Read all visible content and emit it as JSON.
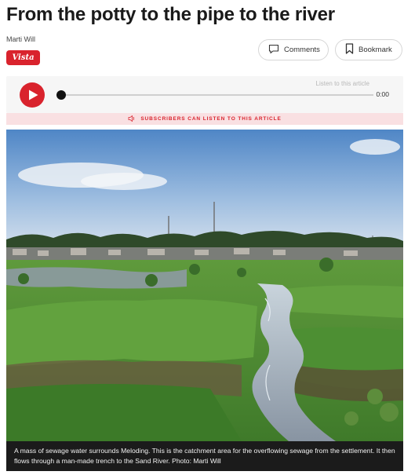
{
  "article": {
    "headline": "From the potty to the pipe to the river",
    "author": "Marti Will",
    "badge": "Vista"
  },
  "actions": {
    "comments_label": "Comments",
    "bookmark_label": "Bookmark"
  },
  "audio": {
    "listen_label": "Listen to this article",
    "time": "0:00",
    "progress": 0,
    "subscribers_notice": "SUBSCRIBERS CAN LISTEN TO THIS ARTICLE"
  },
  "photo": {
    "caption": "A mass of sewage water surrounds Meloding. This is the catchment area for the overflowing sewage from the settlement. It then flows through a man-made trench to the Sand River. Photo: Marti Will"
  },
  "icons": {
    "play": "play-icon",
    "comments": "speech-bubble-icon",
    "bookmark": "bookmark-icon",
    "speaker": "speaker-icon"
  },
  "colors": {
    "accent": "#d9232d",
    "notice_bg": "#f9e0e2",
    "caption_bg": "#1b1b1b"
  }
}
